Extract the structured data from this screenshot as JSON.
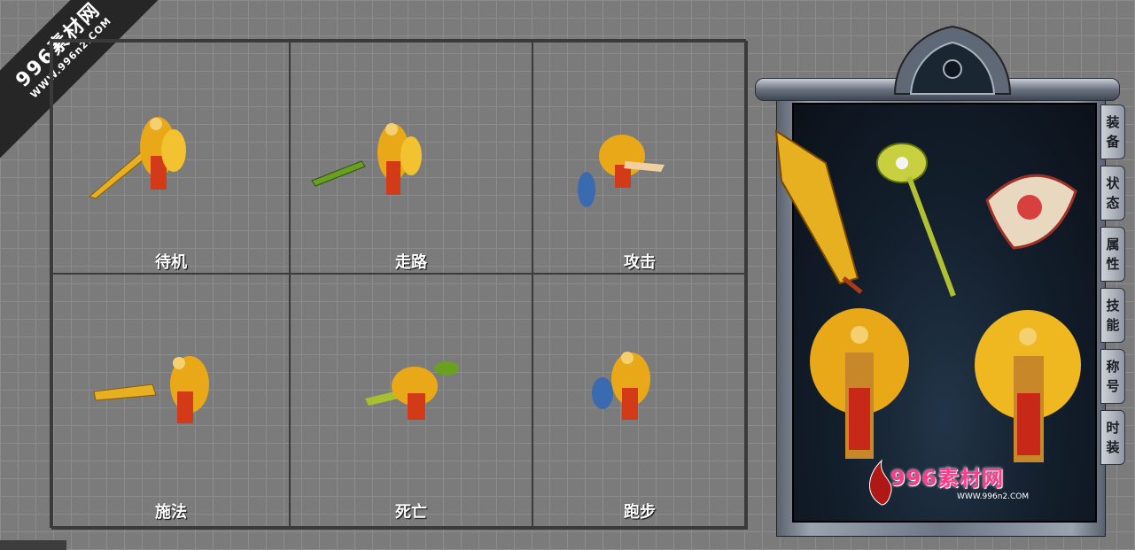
{
  "watermark": {
    "title": "996素材网",
    "url": "WWW.996n2.COM"
  },
  "animations": [
    {
      "label": "待机"
    },
    {
      "label": "走路"
    },
    {
      "label": "攻击"
    },
    {
      "label": "施法"
    },
    {
      "label": "死亡"
    },
    {
      "label": "跑步"
    }
  ],
  "equipment_panel": {
    "tabs": [
      {
        "chars": [
          "装",
          "备"
        ]
      },
      {
        "chars": [
          "状",
          "态"
        ]
      },
      {
        "chars": [
          "属",
          "性"
        ]
      },
      {
        "chars": [
          "技",
          "能"
        ]
      },
      {
        "chars": [
          "称",
          "号"
        ]
      },
      {
        "chars": [
          "时",
          "装"
        ]
      }
    ],
    "brand": {
      "title": "996素材网",
      "url": "WWW.996n2.COM"
    }
  },
  "colors": {
    "gold": "#e6b020",
    "red": "#c02818",
    "panel_bg": "#14202e"
  }
}
